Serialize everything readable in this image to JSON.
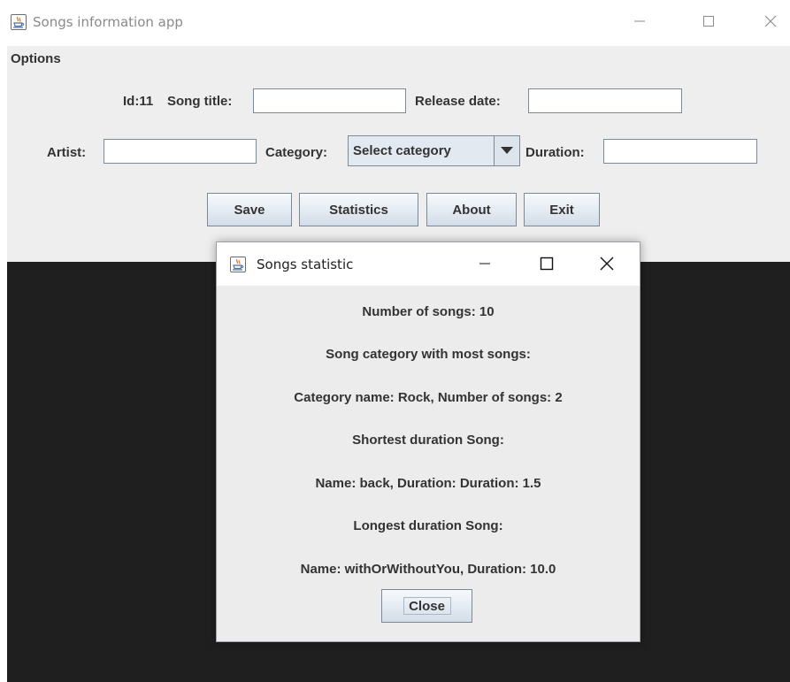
{
  "main_window": {
    "title": "Songs information app",
    "menu": {
      "options_label": "Options"
    },
    "form": {
      "id_label": "Id:11",
      "song_title_label": "Song title:",
      "song_title_value": "",
      "release_date_label": "Release date:",
      "release_date_value": "",
      "artist_label": "Artist:",
      "artist_value": "",
      "category_label": "Category:",
      "category_selected": "Select  category",
      "duration_label": "Duration:",
      "duration_value": ""
    },
    "buttons": {
      "save": "Save",
      "statistics": "Statistics",
      "about": "About",
      "exit": "Exit"
    }
  },
  "dialog": {
    "title": "Songs statistic",
    "lines": [
      "Number of songs: 10",
      "Song category with most songs:",
      "Category name: Rock, Number of songs: 2",
      "Shortest duration Song:",
      "Name: back, Duration: Duration: 1.5",
      "Longest duration Song:",
      "Name: withOrWithoutYou, Duration: 10.0"
    ],
    "close_label": "Close"
  },
  "icons": {
    "app": "java-cup-icon",
    "minimize": "minimize-icon",
    "maximize": "maximize-icon",
    "close": "close-icon",
    "dropdown": "triangle-down-icon"
  },
  "colors": {
    "panel_bg": "#eeeeee",
    "dark_area": "#1f1f1f",
    "button_border": "#7a8a99"
  }
}
